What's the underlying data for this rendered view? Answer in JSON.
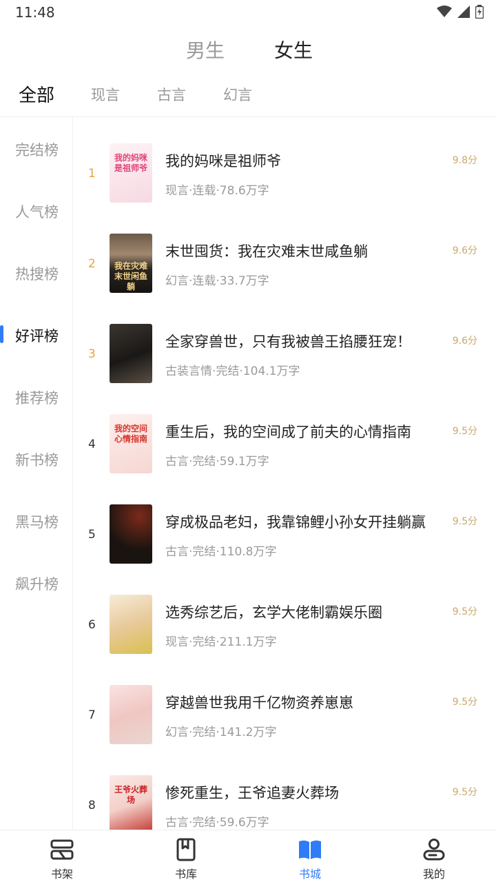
{
  "status": {
    "time": "11:48"
  },
  "gender_tabs": {
    "male": "男生",
    "female": "女生"
  },
  "category_tabs": [
    "全部",
    "现言",
    "古言",
    "幻言"
  ],
  "sidebar": [
    "完结榜",
    "人气榜",
    "热搜榜",
    "好评榜",
    "推荐榜",
    "新书榜",
    "黑马榜",
    "飙升榜"
  ],
  "books": [
    {
      "rank": "1",
      "title": "我的妈咪是祖师爷",
      "meta": "现言·连载·78.6万字",
      "score": "9.8分",
      "cover_text": "我的妈咪是祖师爷"
    },
    {
      "rank": "2",
      "title": "末世囤货：我在灾难末世咸鱼躺",
      "meta": "幻言·连载·33.7万字",
      "score": "9.6分",
      "cover_text": "我在灾难末世闲鱼躺"
    },
    {
      "rank": "3",
      "title": "全家穿兽世，只有我被兽王掐腰狂宠！",
      "meta": "古装言情·完结·104.1万字",
      "score": "9.6分",
      "cover_text": ""
    },
    {
      "rank": "4",
      "title": "重生后，我的空间成了前夫的心情指南",
      "meta": "古言·完结·59.1万字",
      "score": "9.5分",
      "cover_text": "我的空间心情指南"
    },
    {
      "rank": "5",
      "title": "穿成极品老妇，我靠锦鲤小孙女开挂躺赢",
      "meta": "古言·完结·110.8万字",
      "score": "9.5分",
      "cover_text": ""
    },
    {
      "rank": "6",
      "title": "选秀综艺后，玄学大佬制霸娱乐圈",
      "meta": "现言·完结·211.1万字",
      "score": "9.5分",
      "cover_text": ""
    },
    {
      "rank": "7",
      "title": "穿越兽世我用千亿物资养崽崽",
      "meta": "幻言·完结·141.2万字",
      "score": "9.5分",
      "cover_text": ""
    },
    {
      "rank": "8",
      "title": "惨死重生，王爷追妻火葬场",
      "meta": "古言·完结·59.6万字",
      "score": "9.5分",
      "cover_text": "王爷火葬场"
    }
  ],
  "bottom_nav": [
    "书架",
    "书库",
    "书城",
    "我的"
  ],
  "colors": {
    "accent": "#2f7cf6",
    "rank_top": "#e8a23c",
    "score": "#c9a86b"
  },
  "icons": {
    "signal": "signal-icon",
    "wifi": "wifi-icon",
    "battery": "battery-icon"
  }
}
